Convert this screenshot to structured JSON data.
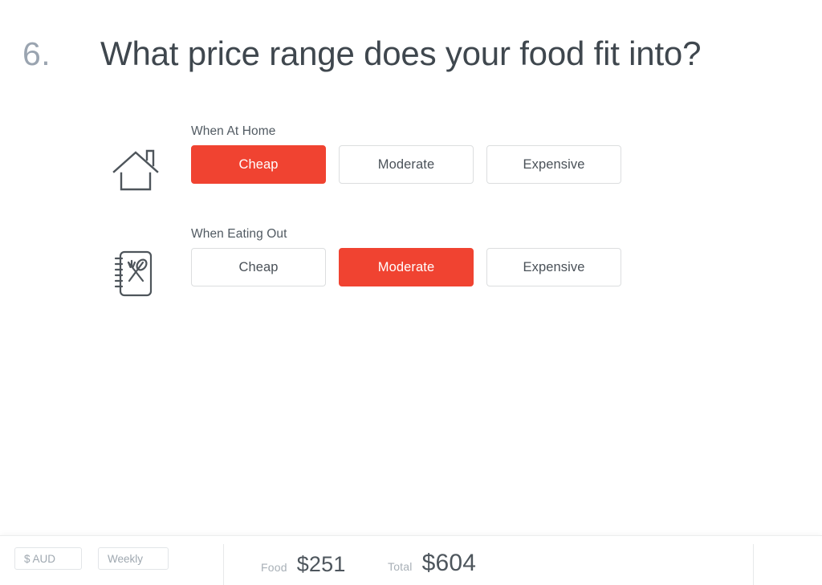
{
  "question": {
    "number": "6.",
    "title": "What price range does your food fit into?"
  },
  "groups": [
    {
      "icon": "house-icon",
      "label": "When At Home",
      "options": [
        {
          "label": "Cheap",
          "selected": true
        },
        {
          "label": "Moderate",
          "selected": false
        },
        {
          "label": "Expensive",
          "selected": false
        }
      ]
    },
    {
      "icon": "menu-notepad-icon",
      "label": "When Eating Out",
      "options": [
        {
          "label": "Cheap",
          "selected": false
        },
        {
          "label": "Moderate",
          "selected": true
        },
        {
          "label": "Expensive",
          "selected": false
        }
      ]
    }
  ],
  "footer": {
    "currency": "$ AUD",
    "period": "Weekly",
    "stats": [
      {
        "label": "Food",
        "value": "$251"
      },
      {
        "label": "Total",
        "value": "$604"
      }
    ]
  },
  "colors": {
    "accent": "#f04331",
    "text_dark": "#4a5158",
    "text_muted": "#9aa4b0",
    "border": "#dcdedf",
    "background": "#ffffff"
  }
}
